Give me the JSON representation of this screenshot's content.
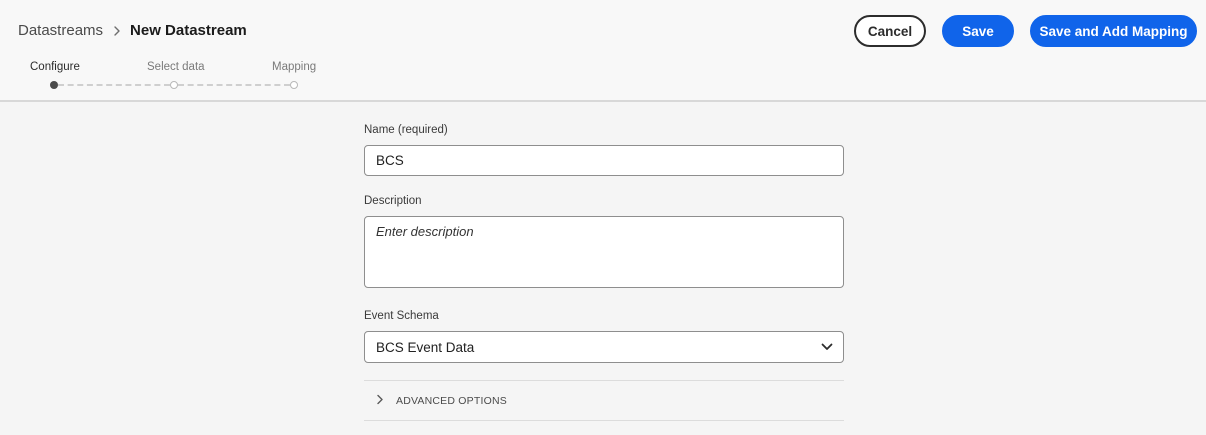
{
  "breadcrumb": {
    "parent": "Datastreams",
    "current": "New Datastream"
  },
  "actions": {
    "cancel_label": "Cancel",
    "save_label": "Save",
    "save_add_mapping_label": "Save and Add Mapping"
  },
  "steps": [
    {
      "label": "Configure",
      "state": "current"
    },
    {
      "label": "Select data",
      "state": "upcoming"
    },
    {
      "label": "Mapping",
      "state": "upcoming"
    }
  ],
  "form": {
    "name_label": "Name (required)",
    "name_value": "BCS",
    "description_label": "Description",
    "description_placeholder": "Enter description",
    "event_schema_label": "Event Schema",
    "event_schema_value": "BCS Event Data",
    "advanced_label": "ADVANCED OPTIONS"
  },
  "colors": {
    "accent": "#1064ea",
    "background": "#f5f5f5"
  }
}
